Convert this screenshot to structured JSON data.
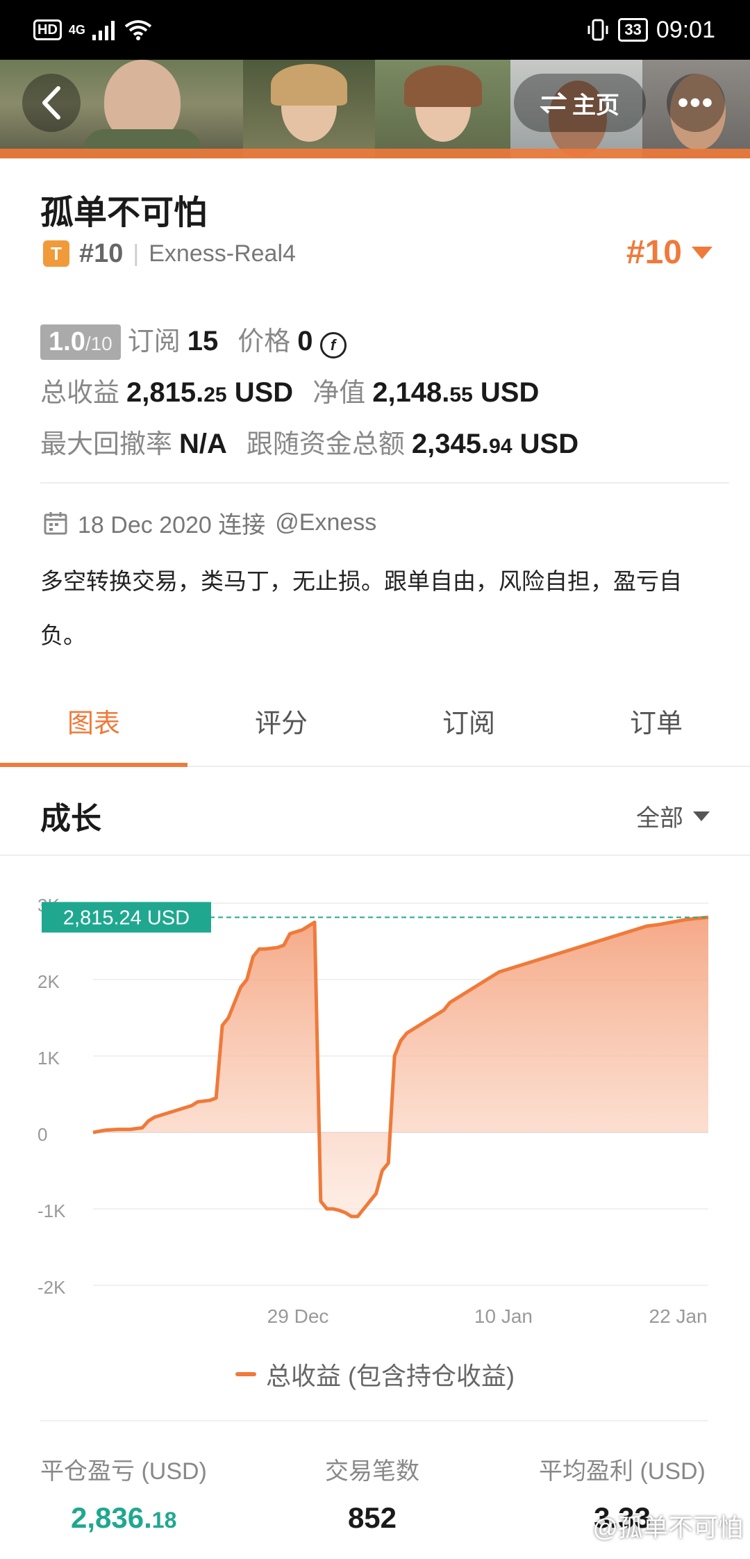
{
  "status_bar": {
    "hd": "HD",
    "network": "4G",
    "battery": "33",
    "time": "09:01"
  },
  "header": {
    "home_label": "主页",
    "more_label": "•••"
  },
  "strategy": {
    "title": "孤单不可怕",
    "badge": "T",
    "rank_label": "#10",
    "account": "Exness-Real4",
    "rank_right": "#10"
  },
  "stats": {
    "score": "1.0",
    "score_max": "/10",
    "subscribe_label": "订阅",
    "subscribe_value": "15",
    "price_label": "价格",
    "price_value": "0",
    "total_profit_label": "总收益",
    "total_profit_main": "2,815.",
    "total_profit_dec": "25",
    "total_profit_unit": "USD",
    "equity_label": "净值",
    "equity_main": "2,148.",
    "equity_dec": "55",
    "equity_unit": "USD",
    "drawdown_label": "最大回撤率",
    "drawdown_value": "N/A",
    "follow_label": "跟随资金总额",
    "follow_main": "2,345.",
    "follow_dec": "94",
    "follow_unit": "USD"
  },
  "info": {
    "date": "18 Dec 2020 连接",
    "broker": "@Exness",
    "description": "多空转换交易，类马丁，无止损。跟单自由，风险自担，盈亏自负。"
  },
  "tabs": [
    {
      "label": "图表",
      "active": true
    },
    {
      "label": "评分",
      "active": false
    },
    {
      "label": "订阅",
      "active": false
    },
    {
      "label": "订单",
      "active": false
    }
  ],
  "growth": {
    "title": "成长",
    "range": "全部"
  },
  "chart_data": {
    "type": "area",
    "current_label": "2,815.24 USD",
    "current_value": 2815.24,
    "y_ticks": [
      "3K",
      "2K",
      "1K",
      "0",
      "-1K",
      "-2K"
    ],
    "y_tick_values": [
      3000,
      2000,
      1000,
      0,
      -1000,
      -2000
    ],
    "ylim": [
      -2000,
      3000
    ],
    "x_ticks": [
      "29 Dec",
      "10 Jan",
      "22 Jan"
    ],
    "x_tick_positions": [
      0.333,
      0.667,
      0.951
    ],
    "grid": true,
    "series": [
      {
        "name": "总收益 (包含持仓收益)",
        "color": "#ef7a3a",
        "x": [
          0.0,
          0.02,
          0.04,
          0.06,
          0.08,
          0.09,
          0.1,
          0.12,
          0.14,
          0.16,
          0.17,
          0.19,
          0.2,
          0.21,
          0.22,
          0.24,
          0.25,
          0.26,
          0.27,
          0.28,
          0.3,
          0.31,
          0.32,
          0.34,
          0.35,
          0.36,
          0.37,
          0.38,
          0.39,
          0.4,
          0.41,
          0.42,
          0.43,
          0.44,
          0.45,
          0.46,
          0.47,
          0.48,
          0.49,
          0.5,
          0.51,
          0.52,
          0.53,
          0.54,
          0.55,
          0.56,
          0.57,
          0.58,
          0.6,
          0.62,
          0.64,
          0.66,
          0.68,
          0.7,
          0.72,
          0.74,
          0.76,
          0.78,
          0.8,
          0.82,
          0.84,
          0.86,
          0.88,
          0.9,
          0.92,
          0.94,
          0.96,
          0.98,
          1.0
        ],
        "values": [
          0,
          30,
          40,
          40,
          60,
          150,
          200,
          250,
          300,
          350,
          400,
          420,
          450,
          1400,
          1500,
          1900,
          2000,
          2300,
          2400,
          2400,
          2420,
          2450,
          2600,
          2650,
          2700,
          2750,
          -900,
          -1000,
          -1000,
          -1020,
          -1050,
          -1100,
          -1100,
          -1000,
          -900,
          -800,
          -500,
          -400,
          1000,
          1200,
          1300,
          1350,
          1400,
          1450,
          1500,
          1550,
          1600,
          1700,
          1800,
          1900,
          2000,
          2100,
          2150,
          2200,
          2250,
          2300,
          2350,
          2400,
          2450,
          2500,
          2550,
          2600,
          2650,
          2700,
          2720,
          2750,
          2780,
          2800,
          2815
        ]
      }
    ]
  },
  "summary": {
    "closed_pl_label": "平仓盈亏 (USD)",
    "closed_pl_main": "2,836.",
    "closed_pl_dec": "18",
    "trades_label": "交易笔数",
    "trades_value": "852",
    "avg_profit_label": "平均盈利 (USD)",
    "avg_profit_value": "3.33"
  },
  "watermark": "@孤单不可怕",
  "colors": {
    "accent": "#ef7a3a",
    "green": "#1fa88f"
  }
}
